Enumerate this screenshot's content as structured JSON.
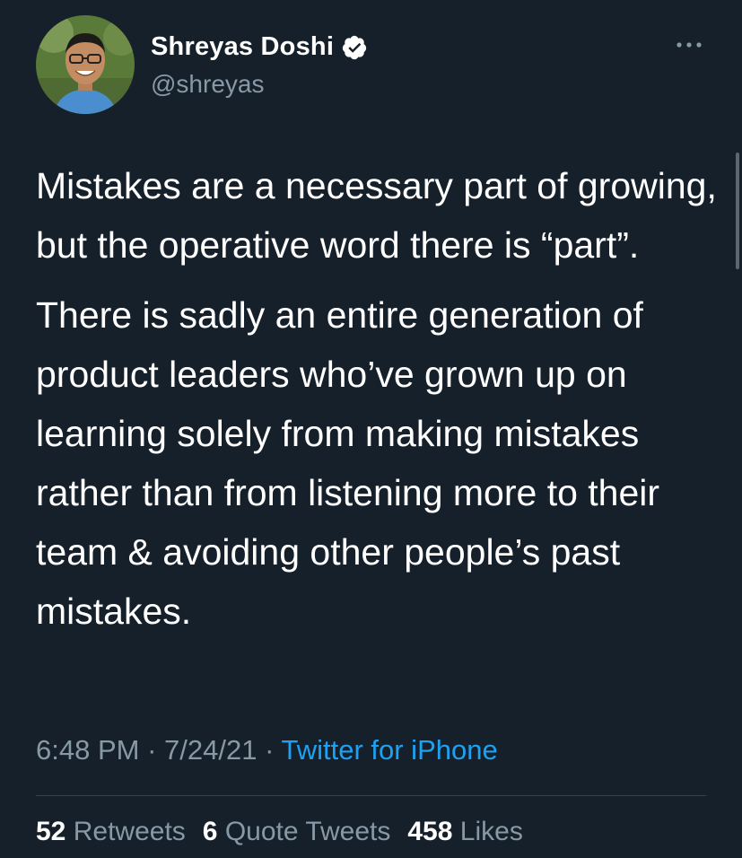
{
  "author": {
    "display_name": "Shreyas Doshi",
    "handle": "@shreyas",
    "verified": true
  },
  "tweet": {
    "paragraphs": [
      "Mistakes are a necessary part of growing, but the operative word there is “part”.",
      "There is sadly an entire generation of product leaders who’ve grown up on learning solely from making mistakes rather than from listening more to their team & avoiding other people’s past mistakes."
    ],
    "time": "6:48 PM",
    "separator": "·",
    "date": "7/24/21",
    "source": "Twitter for iPhone"
  },
  "stats": {
    "retweets": {
      "count": "52",
      "label": "Retweets"
    },
    "quote_tweets": {
      "count": "6",
      "label": "Quote Tweets"
    },
    "likes": {
      "count": "458",
      "label": "Likes"
    }
  },
  "icons": {
    "verified": "verified-badge-icon",
    "more": "more-options-icon"
  },
  "colors": {
    "background": "#15202b",
    "secondary_text": "#8899a6",
    "accent": "#1da1f2"
  }
}
